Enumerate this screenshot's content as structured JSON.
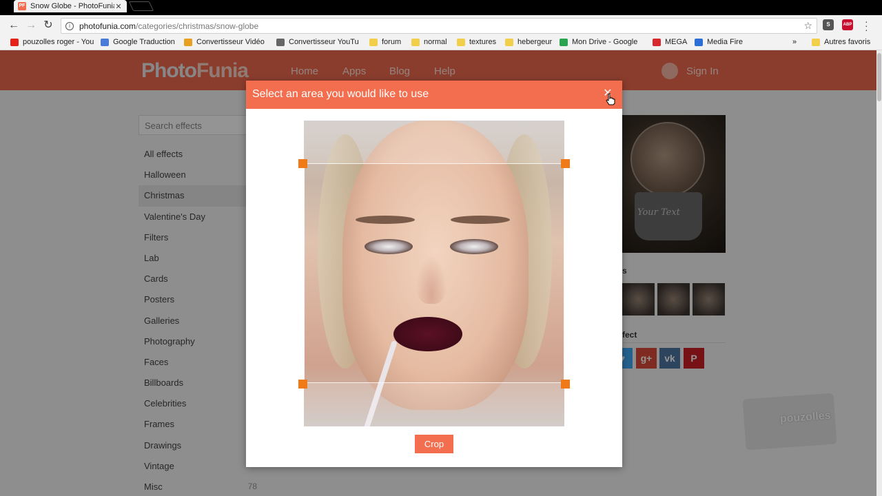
{
  "browser": {
    "tab_title": "Snow Globe - PhotoFunia",
    "tab_close": "✕",
    "favicon_text": "PF",
    "url_host": "photofunia.com",
    "url_path": "/categories/christmas/snow-globe",
    "bookmarks": [
      {
        "label": "pouzolles roger - You",
        "icon": "youtube-icon",
        "color": "#e62117"
      },
      {
        "label": "Google Traduction",
        "icon": "translate-icon",
        "color": "#4a7bd8"
      },
      {
        "label": "Convertisseur Vidéo",
        "icon": "converter-icon",
        "color": "#e8a020"
      },
      {
        "label": "Convertisseur YouTu",
        "icon": "converter2-icon",
        "color": "#666666"
      },
      {
        "label": "forum",
        "icon": "folder-icon",
        "color": "#f2cf4a"
      },
      {
        "label": "normal",
        "icon": "folder-icon",
        "color": "#f2cf4a"
      },
      {
        "label": "textures",
        "icon": "folder-icon",
        "color": "#f2cf4a"
      },
      {
        "label": "hebergeur",
        "icon": "folder-icon",
        "color": "#f2cf4a"
      },
      {
        "label": "Mon Drive - Google",
        "icon": "drive-icon",
        "color": "#2aa44f"
      },
      {
        "label": "MEGA",
        "icon": "mega-icon",
        "color": "#d9272e"
      },
      {
        "label": "Media Fire",
        "icon": "mediafire-icon",
        "color": "#2a6ed6"
      }
    ],
    "bookmarks_more": "»",
    "other_bookmarks": "Autres favoris",
    "extensions": [
      {
        "label": "S",
        "color": "#555555"
      },
      {
        "label": "ABP",
        "color": "#c8102e"
      }
    ]
  },
  "site": {
    "logo_part1": "Photo",
    "logo_part2": "Funia",
    "nav": [
      "Home",
      "Apps",
      "Blog",
      "Help"
    ],
    "sign_in": "Sign In",
    "search_placeholder": "Search effects",
    "categories": [
      {
        "label": "All effects",
        "count": "",
        "active": false
      },
      {
        "label": "Halloween",
        "count": "",
        "active": false
      },
      {
        "label": "Christmas",
        "count": "",
        "active": true
      },
      {
        "label": "Valentine's Day",
        "count": "",
        "active": false
      },
      {
        "label": "Filters",
        "count": "",
        "active": false
      },
      {
        "label": "Lab",
        "count": "",
        "active": false
      },
      {
        "label": "Cards",
        "count": "",
        "active": false
      },
      {
        "label": "Posters",
        "count": "",
        "active": false
      },
      {
        "label": "Galleries",
        "count": "",
        "active": false
      },
      {
        "label": "Photography",
        "count": "",
        "active": false
      },
      {
        "label": "Faces",
        "count": "",
        "active": false
      },
      {
        "label": "Billboards",
        "count": "",
        "active": false
      },
      {
        "label": "Celebrities",
        "count": "",
        "active": false
      },
      {
        "label": "Frames",
        "count": "",
        "active": false
      },
      {
        "label": "Drawings",
        "count": "",
        "active": false
      },
      {
        "label": "Vintage",
        "count": "",
        "active": false
      },
      {
        "label": "Misc",
        "count": "78",
        "active": false
      }
    ],
    "globe_text": "Your Text",
    "examples_label": "s",
    "share_label": "fect",
    "share_buttons": [
      {
        "label": "♥",
        "color": "#3fa9f5"
      },
      {
        "label": "g+",
        "color": "#dd4b39"
      },
      {
        "label": "vk",
        "color": "#4c75a3"
      },
      {
        "label": "P",
        "color": "#cb2027"
      }
    ],
    "watermark": "pouzolles"
  },
  "modal": {
    "title": "Select an area you would like to use",
    "close_symbol": "✕",
    "crop_button": "Crop"
  }
}
